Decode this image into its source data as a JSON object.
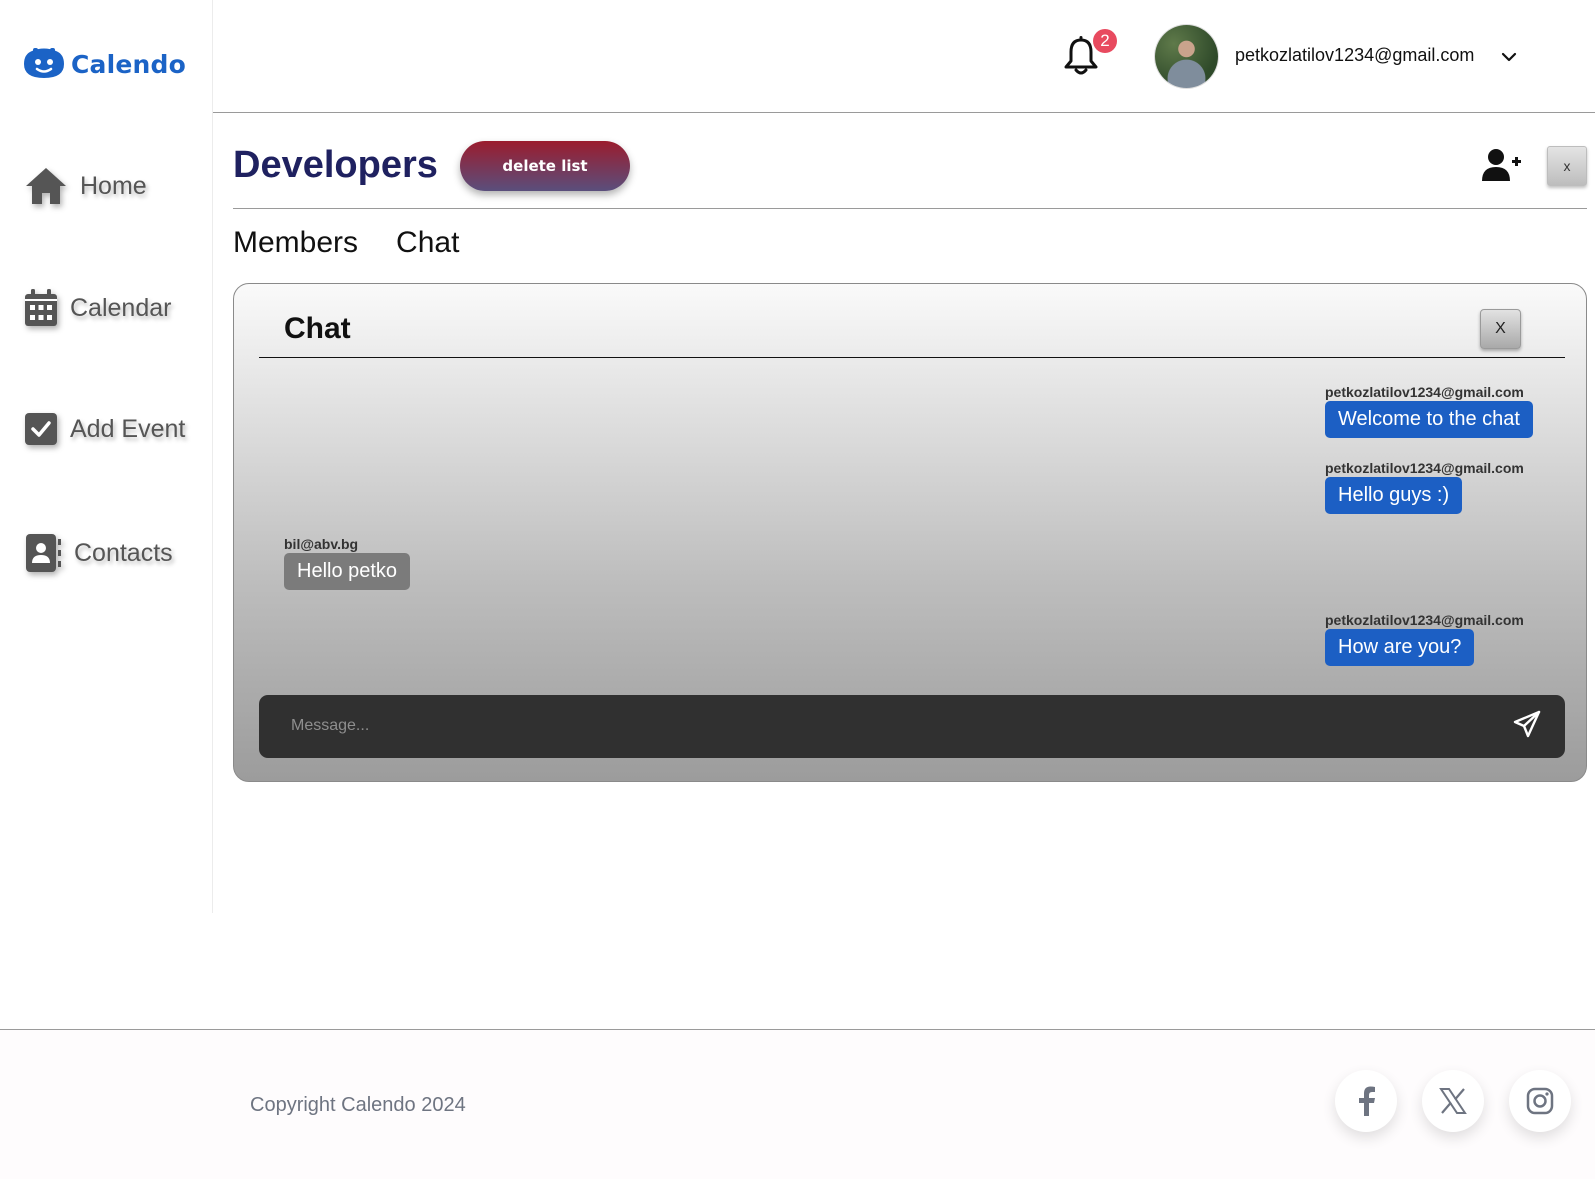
{
  "app": {
    "name": "Calendo"
  },
  "sidebar": {
    "items": [
      {
        "label": "Home",
        "icon": "home-icon"
      },
      {
        "label": "Calendar",
        "icon": "calendar-icon"
      },
      {
        "label": "Add Event",
        "icon": "checkbox-icon"
      },
      {
        "label": "Contacts",
        "icon": "contact-book-icon"
      }
    ]
  },
  "header": {
    "notification_count": "2",
    "user_email": "petkozlatilov1234@gmail.com"
  },
  "list": {
    "title": "Developers",
    "delete_label": "delete list",
    "close_label": "x"
  },
  "tabs": [
    {
      "label": "Members"
    },
    {
      "label": "Chat"
    }
  ],
  "chat": {
    "title": "Chat",
    "close_label": "X",
    "placeholder": "Message...",
    "messages": [
      {
        "sender": "petkozlatilov1234@gmail.com",
        "text": "Welcome to the chat",
        "mine": true
      },
      {
        "sender": "petkozlatilov1234@gmail.com",
        "text": "Hello guys :)",
        "mine": true
      },
      {
        "sender": "bil@abv.bg",
        "text": "Hello petko",
        "mine": false
      },
      {
        "sender": "petkozlatilov1234@gmail.com",
        "text": "How are you?",
        "mine": true
      }
    ]
  },
  "footer": {
    "copyright": "Copyright Calendo 2024",
    "social": [
      "facebook-icon",
      "x-icon",
      "instagram-icon"
    ]
  },
  "colors": {
    "brand": "#1b63c6",
    "title": "#1f2160",
    "my_bubble": "#1c5fc4",
    "other_bubble": "#7b7b7b",
    "badge": "#e84a5f"
  }
}
